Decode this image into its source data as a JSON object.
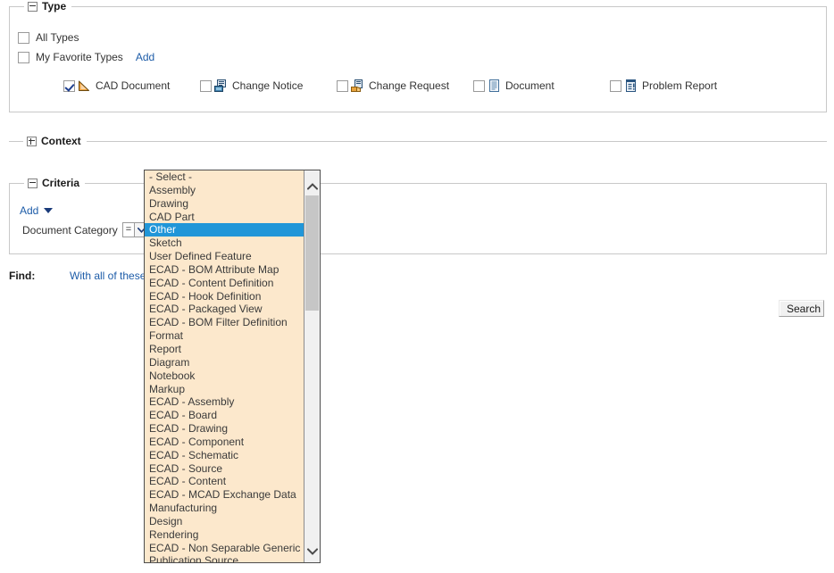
{
  "sections": {
    "type": {
      "legend": "Type",
      "expanded": true
    },
    "context": {
      "legend": "Context",
      "expanded": false
    },
    "criteria": {
      "legend": "Criteria",
      "expanded": true
    }
  },
  "type_section": {
    "all_types": {
      "label": "All Types",
      "checked": false
    },
    "my_favorite_types": {
      "label": "My Favorite Types",
      "checked": false
    },
    "add_link": "Add",
    "types": [
      {
        "label": "CAD Document",
        "checked": true,
        "icon": "cad-document-icon"
      },
      {
        "label": "Change Notice",
        "checked": false,
        "icon": "change-notice-icon"
      },
      {
        "label": "Change Request",
        "checked": false,
        "icon": "change-request-icon"
      },
      {
        "label": "Document",
        "checked": false,
        "icon": "document-icon"
      },
      {
        "label": "Problem Report",
        "checked": false,
        "icon": "problem-report-icon"
      }
    ]
  },
  "criteria_section": {
    "add_link": "Add",
    "attribute_label": "Document Category",
    "operator_value": "=",
    "operator_icon": "chevron-down-icon"
  },
  "find_row": {
    "label": "Find:",
    "text": "With all of these c"
  },
  "search_button": {
    "label": "Search"
  },
  "dropdown": {
    "selected": "Other",
    "scroll_up_icon": "chevron-up-icon",
    "scroll_down_icon": "chevron-down-icon",
    "options": [
      "- Select -",
      "Assembly",
      "Drawing",
      "CAD Part",
      "Other",
      "Sketch",
      "User Defined Feature",
      "ECAD - BOM Attribute Map",
      "ECAD - Content Definition",
      "ECAD - Hook Definition",
      "ECAD - Packaged View",
      "ECAD - BOM Filter Definition",
      "Format",
      "Report",
      "Diagram",
      "Notebook",
      "Markup",
      "ECAD - Assembly",
      "ECAD - Board",
      "ECAD - Drawing",
      "ECAD - Component",
      "ECAD - Schematic",
      "ECAD - Source",
      "ECAD - Content",
      "ECAD - MCAD Exchange Data",
      "Manufacturing",
      "Design",
      "Rendering",
      "ECAD - Non Separable Generic",
      "Publication Source"
    ]
  },
  "colors": {
    "dropdown_background": "#fce8cc",
    "selection": "#2196d8",
    "link": "#1d5ca8",
    "border": "#c8c8c8"
  }
}
